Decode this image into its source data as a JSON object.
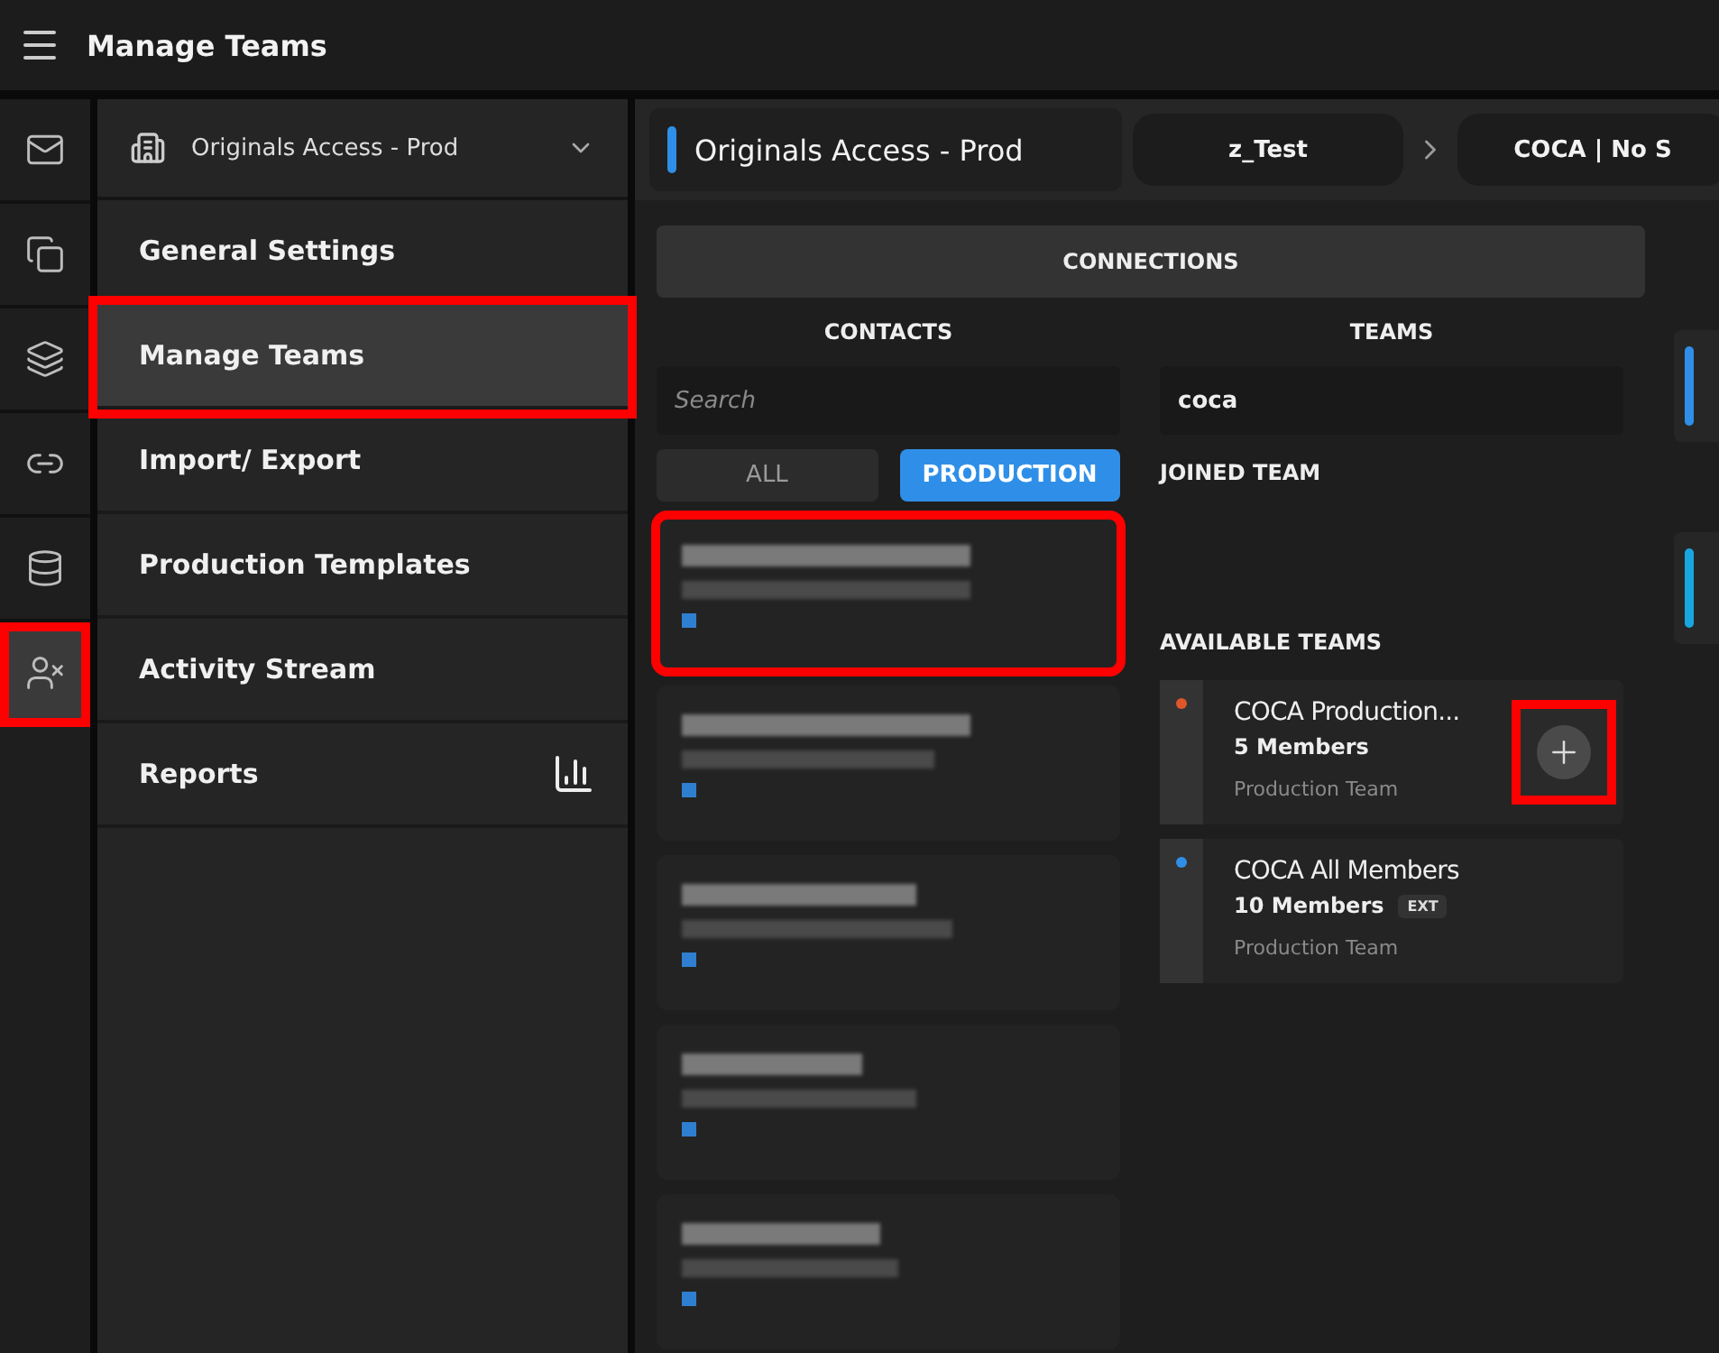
{
  "header": {
    "title": "Manage Teams"
  },
  "icon_rail": [
    {
      "selected": false,
      "highlighted": false
    },
    {
      "selected": false,
      "highlighted": false
    },
    {
      "selected": false,
      "highlighted": false
    },
    {
      "selected": false,
      "highlighted": false
    },
    {
      "selected": false,
      "highlighted": false
    },
    {
      "selected": true,
      "highlighted": true
    }
  ],
  "org_switcher": {
    "label": "Originals Access - Prod"
  },
  "nav": [
    {
      "label": "General Settings",
      "selected": false,
      "highlighted": false
    },
    {
      "label": "Manage Teams",
      "selected": true,
      "highlighted": true
    },
    {
      "label": "Import/ Export",
      "selected": false,
      "highlighted": false
    },
    {
      "label": "Production Templates",
      "selected": false,
      "highlighted": false
    },
    {
      "label": "Activity Stream",
      "selected": false,
      "highlighted": false
    },
    {
      "label": "Reports",
      "selected": false,
      "highlighted": false,
      "kind": "chart"
    }
  ],
  "tabs": [
    {
      "label": "Originals Access - Prod",
      "selected": true
    },
    {
      "label": "z_Test",
      "selected": false
    },
    {
      "label": "COCA | No S",
      "selected": false
    }
  ],
  "connections": {
    "title": "CONNECTIONS"
  },
  "contacts": {
    "title": "CONTACTS",
    "search": {
      "placeholder": "Search"
    },
    "filters": [
      {
        "label": "ALL",
        "selected": false
      },
      {
        "label": "PRODUCTION",
        "selected": true
      }
    ],
    "cards": [
      {
        "highlighted": true
      },
      {
        "highlighted": false
      },
      {
        "highlighted": false
      },
      {
        "highlighted": false
      },
      {
        "highlighted": false
      }
    ]
  },
  "teams": {
    "title": "TEAMS",
    "search": {
      "value": "coca"
    },
    "joined_title": "JOINED TEAM",
    "available_title": "AVAILABLE TEAMS",
    "items": [
      {
        "name": "COCA Production...",
        "members": "5 Members",
        "type": "Production Team",
        "color": "#e0562a",
        "add_button": true,
        "highlighted": true
      },
      {
        "name": "COCA All Members",
        "members": "10 Members",
        "badge": "EXT",
        "type": "Production Team",
        "color": "#2f8fe8",
        "add_button": false,
        "highlighted": false
      }
    ]
  }
}
